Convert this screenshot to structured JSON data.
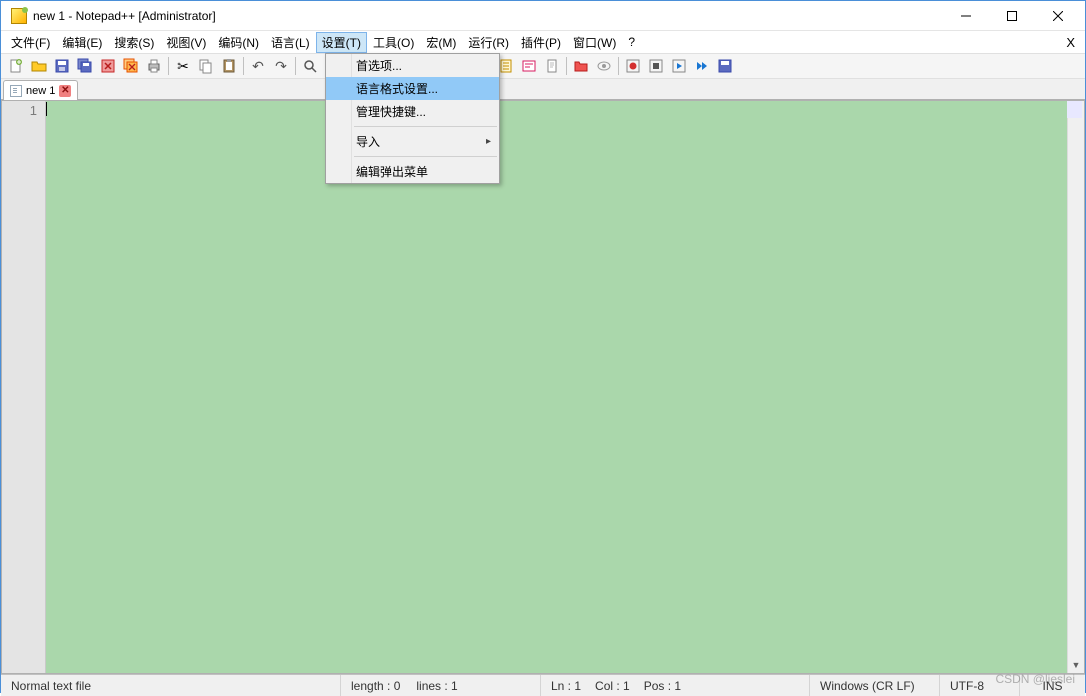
{
  "window": {
    "title": "new 1 - Notepad++  [Administrator]"
  },
  "menubar": {
    "items": [
      {
        "label": "文件(F)"
      },
      {
        "label": "编辑(E)"
      },
      {
        "label": "搜索(S)"
      },
      {
        "label": "视图(V)"
      },
      {
        "label": "编码(N)"
      },
      {
        "label": "语言(L)"
      },
      {
        "label": "设置(T)"
      },
      {
        "label": "工具(O)"
      },
      {
        "label": "宏(M)"
      },
      {
        "label": "运行(R)"
      },
      {
        "label": "插件(P)"
      },
      {
        "label": "窗口(W)"
      },
      {
        "label": "?"
      }
    ],
    "open_index": 6,
    "close_doc": "X"
  },
  "dropdown": {
    "items": [
      {
        "label": "首选项...",
        "type": "item"
      },
      {
        "label": "语言格式设置...",
        "type": "item",
        "highlight": true
      },
      {
        "label": "管理快捷键...",
        "type": "item"
      },
      {
        "label": "导入",
        "type": "submenu"
      },
      {
        "label": "编辑弹出菜单",
        "type": "item"
      }
    ]
  },
  "tabs": [
    {
      "label": "new 1"
    }
  ],
  "editor": {
    "gutter_line": "1"
  },
  "statusbar": {
    "filetype": "Normal text file",
    "length_label": "length : 0",
    "lines_label": "lines : 1",
    "ln": "Ln : 1",
    "col": "Col : 1",
    "pos": "Pos : 1",
    "eol": "Windows (CR LF)",
    "encoding": "UTF-8",
    "mode": "INS"
  },
  "watermark": "CSDN @lieslei"
}
